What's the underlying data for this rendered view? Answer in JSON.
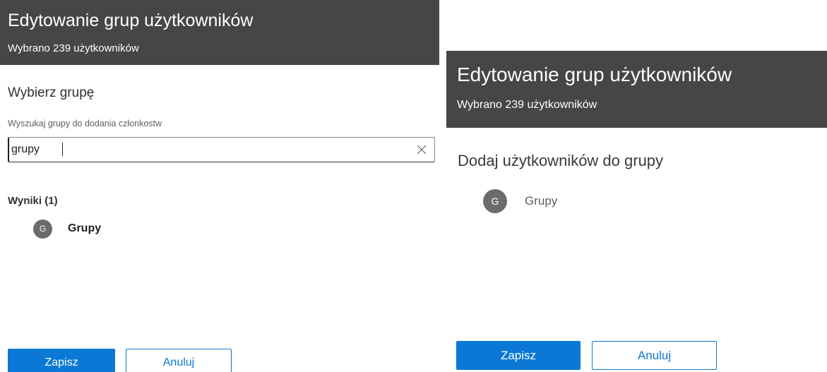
{
  "left_panel": {
    "header": {
      "title": "Edytowanie grup użytkowników",
      "subtitle": "Wybrano 239 użytkowników"
    },
    "section_title": "Wybierz grupę",
    "search": {
      "label": "Wyszukaj grupy do dodania członkostw",
      "value": "grupy",
      "clear_icon": "close-icon"
    },
    "results": {
      "label": "Wyniki (1)",
      "items": [
        {
          "initial": "G",
          "name": "Grupy"
        }
      ]
    },
    "buttons": {
      "save_label": "Zapisz",
      "cancel_label": "Anuluj"
    }
  },
  "right_panel": {
    "header": {
      "title": "Edytowanie grup użytkowników",
      "subtitle": "Wybrano 239 użytkowników"
    },
    "section_title": "Dodaj użytkowników do grupy",
    "selected_group": {
      "initial": "G",
      "name": "Grupy"
    },
    "buttons": {
      "save_label": "Zapisz",
      "cancel_label": "Anuluj"
    }
  },
  "colors": {
    "header_bg": "#464646",
    "primary": "#0a78d4",
    "avatar_bg": "#6b6b6b",
    "text": "#323130"
  }
}
